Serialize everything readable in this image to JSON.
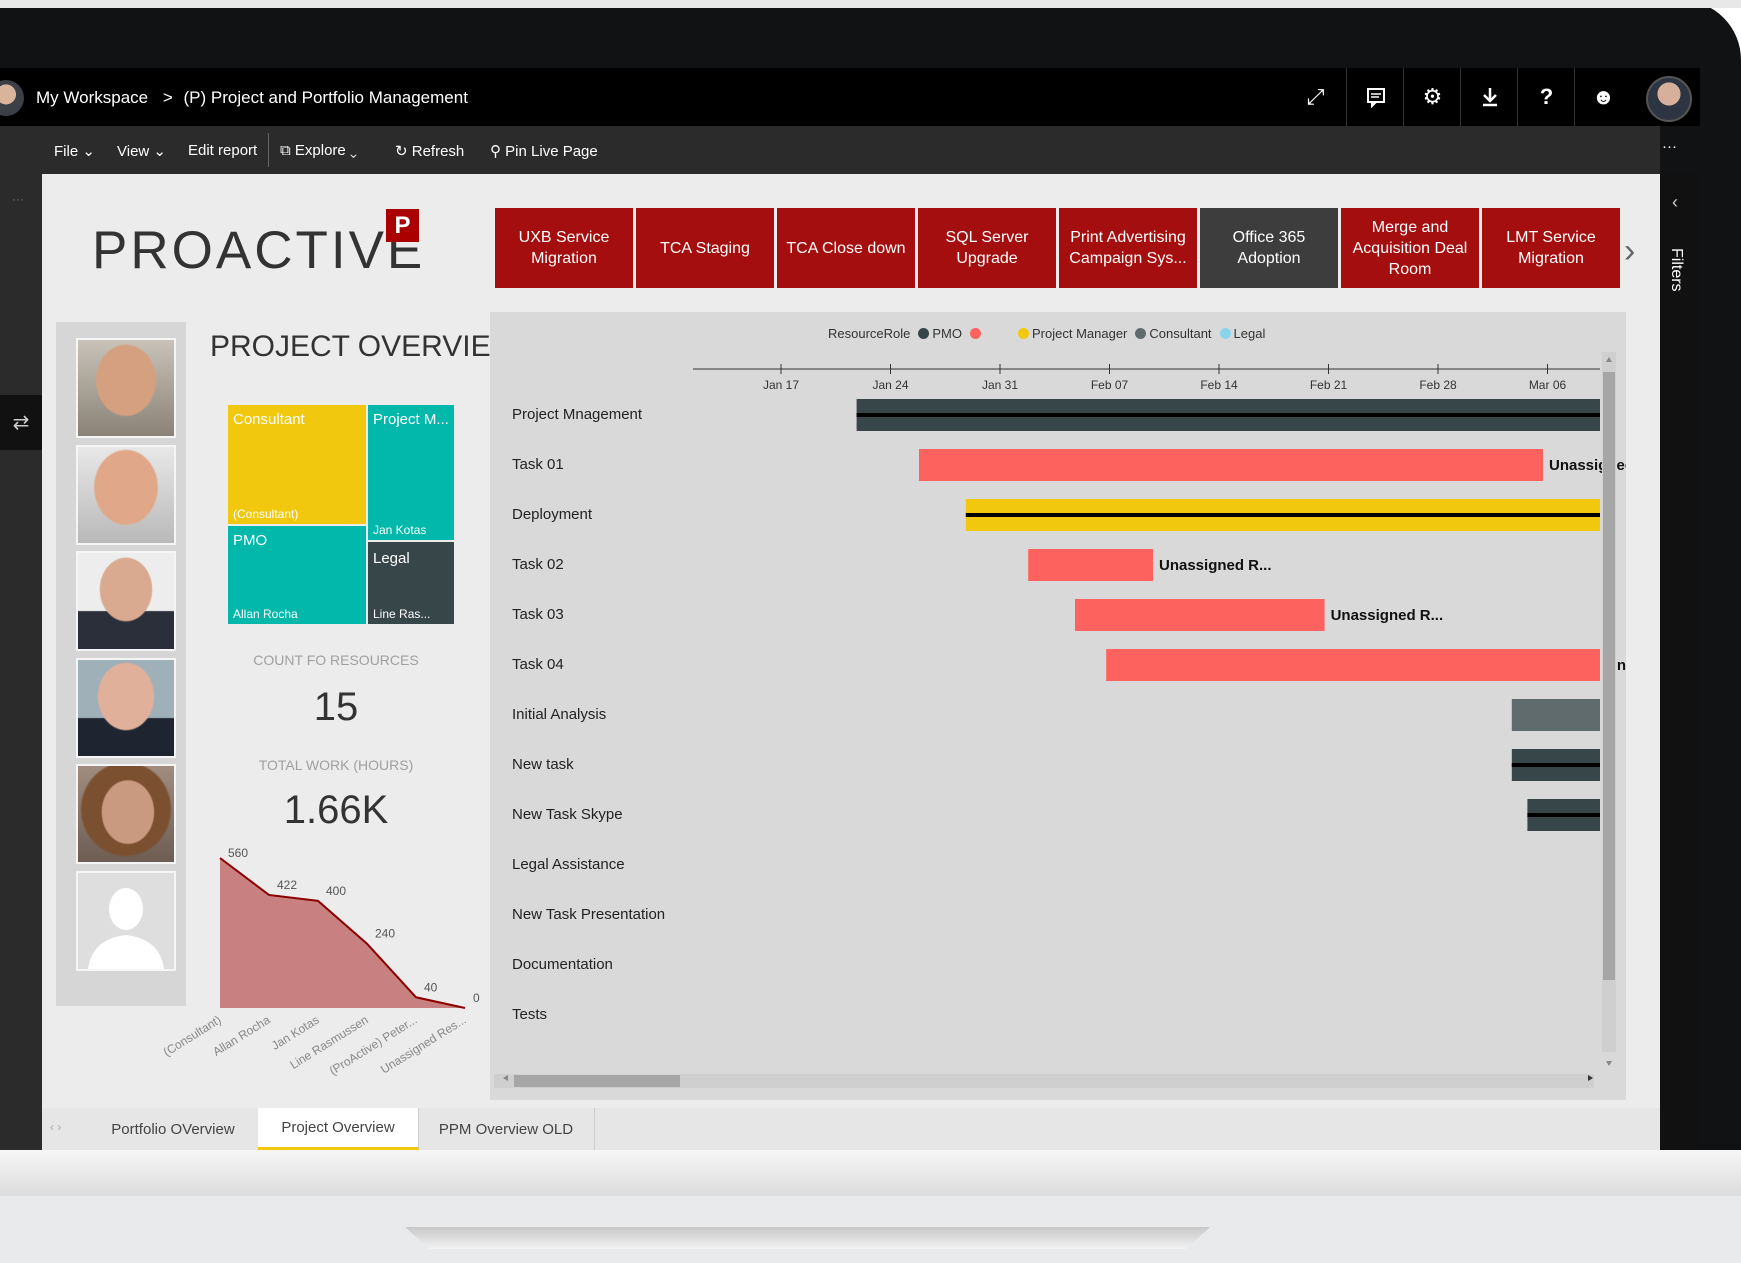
{
  "header": {
    "workspace": "My Workspace",
    "separator": ">",
    "report": "(P) Project and Portfolio Management",
    "icons": [
      "expand-icon",
      "comment-icon",
      "gear-icon",
      "download-icon",
      "help-icon",
      "smiley-icon"
    ]
  },
  "toolbar": {
    "file": "File",
    "view": "View",
    "edit_report": "Edit report",
    "explore": "Explore",
    "refresh": "Refresh",
    "pin": "Pin Live Page",
    "more": "···"
  },
  "right_rail": {
    "label": "Filters"
  },
  "brand": {
    "logo_text": "PROACTIVE",
    "logo_mark": "P"
  },
  "project_tiles": [
    {
      "label": "UXB Service Migration",
      "color": "#a50e0e"
    },
    {
      "label": "TCA Staging",
      "color": "#a50e0e"
    },
    {
      "label": "TCA Close down",
      "color": "#a50e0e"
    },
    {
      "label": "SQL Server Upgrade",
      "color": "#a50e0e"
    },
    {
      "label": "Print Advertising Campaign Sys...",
      "color": "#a50e0e"
    },
    {
      "label": "Office 365 Adoption",
      "color": "#3d3d3d"
    },
    {
      "label": "Merge and Acquisition Deal Room",
      "color": "#a50e0e"
    },
    {
      "label": "LMT Service Migration",
      "color": "#a50e0e"
    }
  ],
  "overview": {
    "title": "PROJECT OVERVIEW",
    "treemap": {
      "consultant": {
        "title": "Consultant",
        "sub": "(Consultant)",
        "color": "#f2c80f"
      },
      "project_manager": {
        "title": "Project M...",
        "sub": "Jan Kotas",
        "color": "#01b8aa"
      },
      "pmo": {
        "title": "PMO",
        "sub": "Allan Rocha",
        "color": "#01b8aa"
      },
      "legal": {
        "title": "Legal",
        "sub": "Line Ras...",
        "color": "#374649"
      }
    },
    "count_label": "COUNT FO RESOURCES",
    "count_value": "15",
    "work_label": "TOTAL WORK (HOURS)",
    "work_value": "1.66K"
  },
  "chart_data": [
    {
      "type": "area",
      "categories": [
        "(Consultant)",
        "Allan Rocha",
        "Jan Kotas",
        "Line Rasmussen",
        "(ProActive) Peter...",
        "Unassigned Res..."
      ],
      "values": [
        560,
        422,
        400,
        240,
        40,
        0
      ],
      "data_labels": [
        "560",
        "422",
        "400",
        "240",
        "40",
        "0"
      ],
      "colors": {
        "fill": "#c98080",
        "line": "#8b0000"
      }
    },
    {
      "type": "gantt",
      "legend_title": "ResourceRole",
      "legend": [
        {
          "name": "PMO",
          "color": "#374649"
        },
        {
          "name": "",
          "color": "#fd625e"
        },
        {
          "name": "Project Manager",
          "color": "#f2c80f"
        },
        {
          "name": "Consultant",
          "color": "#5f6b6d"
        },
        {
          "name": "Legal",
          "color": "#8ad4eb"
        }
      ],
      "x_ticks": [
        "Jan 17",
        "Jan 24",
        "Jan 31",
        "Feb 07",
        "Feb 14",
        "Feb 21",
        "Feb 28",
        "Mar 06"
      ],
      "tasks": [
        {
          "name": "Project Mnagement",
          "start": 11,
          "end": 69,
          "progress_end": 69,
          "color": "#374649",
          "label": ""
        },
        {
          "name": "Task 01",
          "start": 15,
          "end": 55,
          "color": "#fd625e",
          "label": "Unassigned R..."
        },
        {
          "name": "Deployment",
          "start": 18,
          "end": 69,
          "progress_end": 62,
          "color": "#f2c80f",
          "label": ""
        },
        {
          "name": "Task 02",
          "start": 22,
          "end": 30,
          "color": "#fd625e",
          "label": "Unassigned R..."
        },
        {
          "name": "Task 03",
          "start": 25,
          "end": 41,
          "color": "#fd625e",
          "label": "Unassigned R..."
        },
        {
          "name": "Task 04",
          "start": 27,
          "end": 59,
          "color": "#fd625e",
          "label": "Unassigned R..."
        },
        {
          "name": "Initial Analysis",
          "start": 53,
          "end": 69,
          "color": "#5f6b6d",
          "label": ""
        },
        {
          "name": "New task",
          "start": 53,
          "end": 69,
          "progress_end": 64,
          "color": "#374649",
          "label": ""
        },
        {
          "name": "New Task Skype",
          "start": 54,
          "end": 69,
          "progress_end": 63,
          "color": "#374649",
          "label": ""
        },
        {
          "name": "Legal Assistance",
          "start": 67,
          "end": 69,
          "color": "#8ad4eb",
          "label": ""
        },
        {
          "name": "New Task Presentation",
          "start": null,
          "end": null,
          "color": "",
          "label": ""
        },
        {
          "name": "Documentation",
          "start": null,
          "end": null,
          "color": "",
          "label": ""
        },
        {
          "name": "Tests",
          "start": null,
          "end": null,
          "color": "",
          "label": ""
        }
      ]
    }
  ],
  "tabs": [
    {
      "label": "Portfolio OVerview",
      "active": false
    },
    {
      "label": "Project Overview",
      "active": true
    },
    {
      "label": "PPM Overview OLD",
      "active": false
    }
  ]
}
